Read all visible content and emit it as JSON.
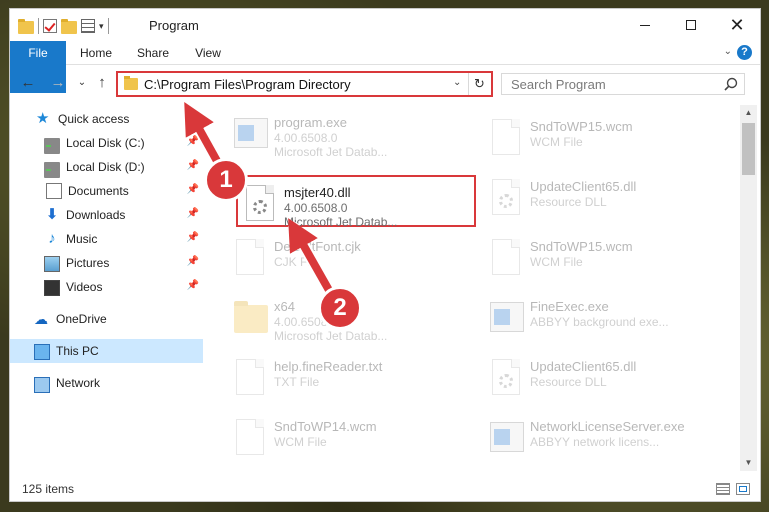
{
  "window": {
    "title": "Program",
    "controls": {
      "minimize": "—",
      "maximize": "☐",
      "close": "✕"
    }
  },
  "ribbon": {
    "tabs": [
      "File",
      "Home",
      "Share",
      "View"
    ],
    "expand": "⌄",
    "help": "?"
  },
  "nav": {
    "back": "←",
    "forward": "→",
    "recent": "⌄",
    "up": "↑",
    "address": "C:\\Program Files\\Program Directory",
    "address_dropdown": "⌄",
    "refresh": "↻",
    "search_placeholder": "Search Program"
  },
  "sidebar": {
    "items": [
      {
        "label": "Quick access",
        "icon": "star-icon",
        "pinned": false
      },
      {
        "label": "Local Disk (C:)",
        "icon": "disk-icon",
        "pinned": true
      },
      {
        "label": "Local Disk (D:)",
        "icon": "disk-icon",
        "pinned": true
      },
      {
        "label": "Documents",
        "icon": "documents-icon",
        "pinned": true
      },
      {
        "label": "Downloads",
        "icon": "downloads-icon",
        "pinned": true
      },
      {
        "label": "Music",
        "icon": "music-icon",
        "pinned": true
      },
      {
        "label": "Pictures",
        "icon": "pictures-icon",
        "pinned": true
      },
      {
        "label": "Videos",
        "icon": "videos-icon",
        "pinned": true
      },
      {
        "label": "OneDrive",
        "icon": "onedrive-icon",
        "pinned": false
      },
      {
        "label": "This PC",
        "icon": "this-pc-icon",
        "pinned": false,
        "selected": true
      },
      {
        "label": "Network",
        "icon": "network-icon",
        "pinned": false
      }
    ],
    "pin_glyph": "📌"
  },
  "files": {
    "left": [
      {
        "name": "program.exe",
        "line1": "4.00.6508.0",
        "line2": "Microsoft Jet Datab...",
        "icon": "exe-icon"
      },
      {
        "name": "msjter40.dll",
        "line1": "4.00.6508.0",
        "line2": "Microsoft Jet Datab...",
        "icon": "dll-gear-icon",
        "highlighted": true
      },
      {
        "name": "DefaultFont.cjk",
        "line1": "CJK File",
        "line2": "",
        "icon": "page-icon"
      },
      {
        "name": "x64",
        "line1": "4.00.6508.0",
        "line2": "Microsoft Jet Datab...",
        "icon": "folder-icon"
      },
      {
        "name": "help.fineReader.txt",
        "line1": "TXT File",
        "line2": "",
        "icon": "page-icon"
      },
      {
        "name": "SndToWP14.wcm",
        "line1": "WCM File",
        "line2": "",
        "icon": "page-icon"
      }
    ],
    "right": [
      {
        "name": "SndToWP15.wcm",
        "line1": "WCM File",
        "line2": "",
        "icon": "page-icon"
      },
      {
        "name": "UpdateClient65.dll",
        "line1": "Resource DLL",
        "line2": "",
        "icon": "dll-gear-icon"
      },
      {
        "name": "SndToWP15.wcm",
        "line1": "WCM File",
        "line2": "",
        "icon": "page-icon"
      },
      {
        "name": "FineExec.exe",
        "line1": "ABBYY background exe...",
        "line2": "",
        "icon": "exe-icon"
      },
      {
        "name": "UpdateClient65.dll",
        "line1": "Resource DLL",
        "line2": "",
        "icon": "dll-gear-icon"
      },
      {
        "name": "NetworkLicenseServer.exe",
        "line1": "ABBYY network licens...",
        "line2": "",
        "icon": "exe-icon"
      }
    ]
  },
  "status": {
    "items_count": "125 items"
  },
  "callouts": [
    {
      "number": "1"
    },
    {
      "number": "2"
    }
  ],
  "colors": {
    "accent": "#1979ca",
    "highlight": "#d9383a",
    "selected_bg": "#cce8ff"
  }
}
